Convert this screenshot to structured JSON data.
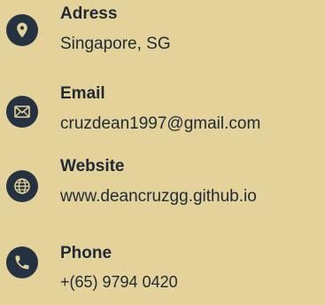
{
  "colors": {
    "background": "#e3d39a",
    "icon_circle": "#243241",
    "text": "#1f2a36"
  },
  "contacts": [
    {
      "label": "Adress",
      "value": "Singapore, SG",
      "icon": "location-pin-icon"
    },
    {
      "label": "Email",
      "value": "cruzdean1997@gmail.com",
      "icon": "envelope-icon"
    },
    {
      "label": "Website",
      "value": "www.deancruzgg.github.io",
      "icon": "globe-icon"
    },
    {
      "label": "Phone",
      "value": "+(65) 9794 0420",
      "icon": "phone-icon"
    }
  ]
}
